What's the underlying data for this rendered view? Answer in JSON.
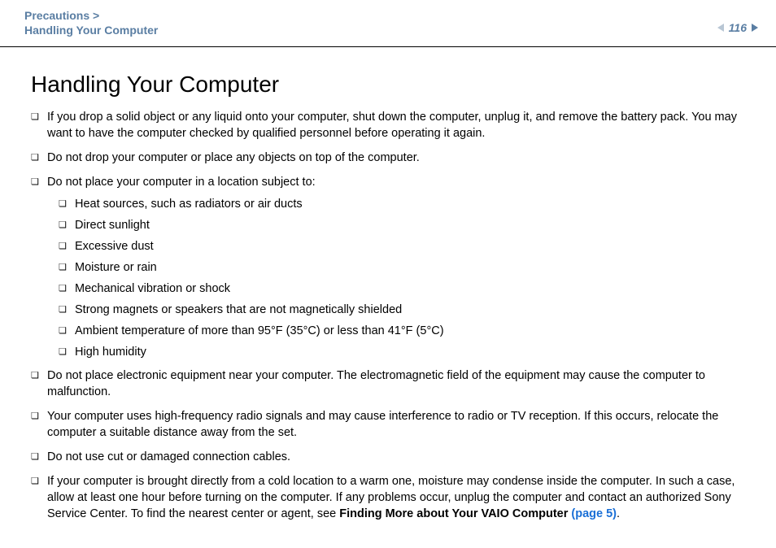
{
  "header": {
    "breadcrumb_parent": "Precautions >",
    "breadcrumb_child": "Handling Your Computer",
    "page_number": "116"
  },
  "title": "Handling Your Computer",
  "bullets": {
    "b1": "If you drop a solid object or any liquid onto your computer, shut down the computer, unplug it, and remove the battery pack. You may want to have the computer checked by qualified personnel before operating it again.",
    "b2": "Do not drop your computer or place any objects on top of the computer.",
    "b3": "Do not place your computer in a location subject to:",
    "b3_sub": {
      "s1": "Heat sources, such as radiators or air ducts",
      "s2": "Direct sunlight",
      "s3": "Excessive dust",
      "s4": "Moisture or rain",
      "s5": "Mechanical vibration or shock",
      "s6": "Strong magnets or speakers that are not magnetically shielded",
      "s7": "Ambient temperature of more than 95°F (35°C) or less than 41°F (5°C)",
      "s8": "High humidity"
    },
    "b4": "Do not place electronic equipment near your computer. The electromagnetic field of the equipment may cause the computer to malfunction.",
    "b5": "Your computer uses high-frequency radio signals and may cause interference to radio or TV reception. If this occurs, relocate the computer a suitable distance away from the set.",
    "b6": "Do not use cut or damaged connection cables.",
    "b7_pre": "If your computer is brought directly from a cold location to a warm one, moisture may condense inside the computer. In such a case, allow at least one hour before turning on the computer. If any problems occur, unplug the computer and contact an authorized Sony Service Center. To find the nearest center or agent, see ",
    "b7_bold": "Finding More about Your VAIO Computer ",
    "b7_link": "(page 5)",
    "b7_post": "."
  }
}
